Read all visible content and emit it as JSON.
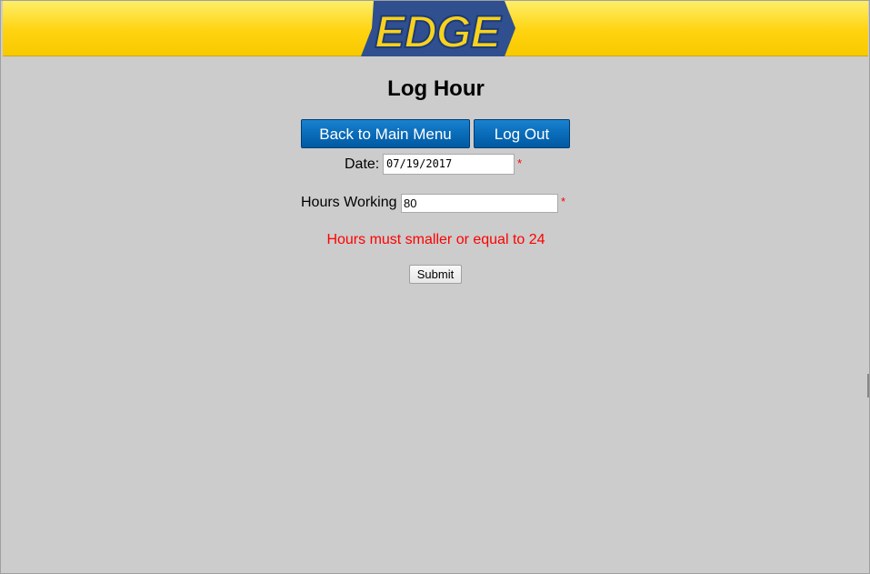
{
  "header": {
    "logo_text": "EDGE",
    "logo_colors": {
      "fill": "#f8d21c",
      "outline": "#2f4f8f",
      "bar_top": "#fdee6a",
      "bar_bottom": "#f7c900"
    }
  },
  "page": {
    "title": "Log Hour",
    "background": "#cccccc"
  },
  "nav": {
    "back_label": "Back to Main Menu",
    "logout_label": "Log Out",
    "button_color": "#0a6cb9"
  },
  "form": {
    "date": {
      "label": "Date:",
      "value": "07/19/2017",
      "required_marker": "*"
    },
    "hours": {
      "label": "Hours Working",
      "value": "80",
      "required_marker": "*"
    },
    "error": "Hours must smaller or equal to 24",
    "submit_label": "Submit",
    "error_color": "#ff0000"
  }
}
